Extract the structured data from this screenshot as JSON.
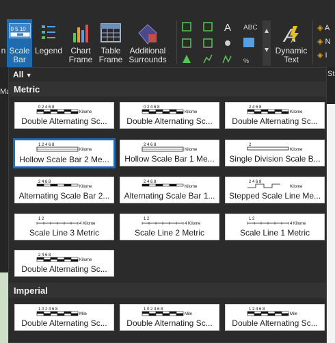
{
  "ribbon": {
    "scale_bar_label": "Scale Bar",
    "scale_bar_icon_text": "0 5 10",
    "legend_label": "Legend",
    "chart_frame_label": "Chart Frame",
    "table_frame_label": "Table Frame",
    "additional_surrounds_label": "Additional Surrounds",
    "dynamic_text_label": "Dynamic Text",
    "left_cut_label": "n",
    "right_cut_labels": [
      "A",
      "N",
      "I"
    ],
    "right_cut_st": "St",
    "ma_cut": "Ma"
  },
  "gallery": {
    "filter_label": "All",
    "sections": [
      {
        "name": "Metric",
        "items": [
          {
            "label": "Double Alternating Sc...",
            "unit": "Kilome",
            "ticks": "0 2 4 6 8",
            "style": "double"
          },
          {
            "label": "Double Alternating Sc...",
            "unit": "Kilome",
            "ticks": "0 2 4 6 8",
            "style": "double"
          },
          {
            "label": "Double Alternating Sc...",
            "unit": "Kilome",
            "ticks": "2 4 6 8",
            "style": "double"
          },
          {
            "label": "Hollow Scale Bar 2 Me...",
            "unit": "Kilome",
            "ticks": "1 2 4 6 8",
            "style": "hollow",
            "selected": true
          },
          {
            "label": "Hollow Scale Bar 1 Me...",
            "unit": "Kilome",
            "ticks": "2 4 6 8",
            "style": "hollow"
          },
          {
            "label": "Single Division Scale B...",
            "unit": "Kilome",
            "ticks": "2",
            "style": "single"
          },
          {
            "label": "Alternating Scale Bar 2...",
            "unit": "Kilome",
            "ticks": "2 4 6 8",
            "style": "alt"
          },
          {
            "label": "Alternating Scale Bar 1...",
            "unit": "Kilome",
            "ticks": "2 4 6 8",
            "style": "alt"
          },
          {
            "label": "Stepped Scale Line Me...",
            "unit": "Kilome",
            "ticks": "2 4 6 8",
            "style": "stepped"
          },
          {
            "label": "Scale Line 3 Metric",
            "unit": "4 Kilome",
            "ticks": "1 2",
            "style": "line"
          },
          {
            "label": "Scale Line 2 Metric",
            "unit": "4 Kilome",
            "ticks": "1 2",
            "style": "line"
          },
          {
            "label": "Scale Line 1 Metric",
            "unit": "4 Kilome",
            "ticks": "1 2",
            "style": "line"
          },
          {
            "label": "Double Alternating Sc...",
            "unit": "Kilome",
            "ticks": "2 4 6 8",
            "style": "double"
          }
        ]
      },
      {
        "name": "Imperial",
        "items": [
          {
            "label": "Double Alternating Sc...",
            "unit": "Mile",
            "ticks": "1 0 2 4 6 8",
            "style": "double"
          },
          {
            "label": "Double Alternating Sc...",
            "unit": "Mile",
            "ticks": "1 0 2 4 6 8",
            "style": "double"
          },
          {
            "label": "Double Alternating Sc...",
            "unit": "Mile",
            "ticks": "1 2 4 6 8",
            "style": "double"
          }
        ]
      }
    ]
  },
  "colors": {
    "accent": "#1f6bb0",
    "panel": "#2b2b2b",
    "section": "#333333",
    "text": "#f0f0f0",
    "icon_green": "#5cc15c",
    "icon_gold": "#e0a020"
  }
}
